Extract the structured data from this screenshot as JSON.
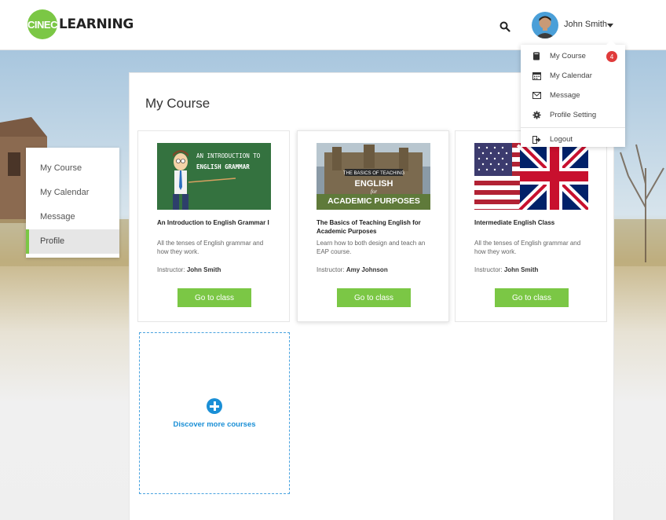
{
  "header": {
    "logo_badge": "CINEC",
    "logo_text": "LEARNING",
    "search_icon": "search-icon",
    "user_name": "John Smith"
  },
  "sidebar": {
    "items": [
      {
        "label": "My Course",
        "active": false
      },
      {
        "label": "My Calendar",
        "active": false
      },
      {
        "label": "Message",
        "active": false
      },
      {
        "label": "Profile",
        "active": true
      }
    ]
  },
  "main": {
    "title": "My Course",
    "courses": [
      {
        "thumb_text": [
          "AN INTRODUCTION TO",
          "ENGLISH GRAMMAR"
        ],
        "title": "An Introduction to English Grammar I",
        "description": "All the tenses of English grammar and how they work.",
        "instructor_label": "Instructor:",
        "instructor": "John Smith",
        "button": "Go to class"
      },
      {
        "thumb_text": [
          "THE BASICS OF TEACHING",
          "ENGLISH",
          "for",
          "ACADEMIC PURPOSES"
        ],
        "title": "The Basics of Teaching English for Academic Purposes",
        "description": "Learn how to both design and teach an EAP course.",
        "instructor_label": "Instructor:",
        "instructor": "Amy Johnson",
        "button": "Go to class"
      },
      {
        "title": "Intermediate English Class",
        "description": "All the tenses of English grammar and how they work.",
        "instructor_label": "Instructor:",
        "instructor": "John Smith",
        "button": "Go to class"
      }
    ],
    "discover_label": "Discover more courses"
  },
  "dropdown": {
    "items": [
      {
        "label": "My Course",
        "icon": "book-icon",
        "badge": "4"
      },
      {
        "label": "My Calendar",
        "icon": "calendar-icon"
      },
      {
        "label": "Message",
        "icon": "envelope-icon"
      },
      {
        "label": "Profile Setting",
        "icon": "gear-icon"
      },
      {
        "label": "Logout",
        "icon": "logout-icon"
      }
    ]
  },
  "colors": {
    "accent_green": "#7bc745",
    "link_blue": "#1a8fd6",
    "badge_red": "#e03b3b"
  }
}
